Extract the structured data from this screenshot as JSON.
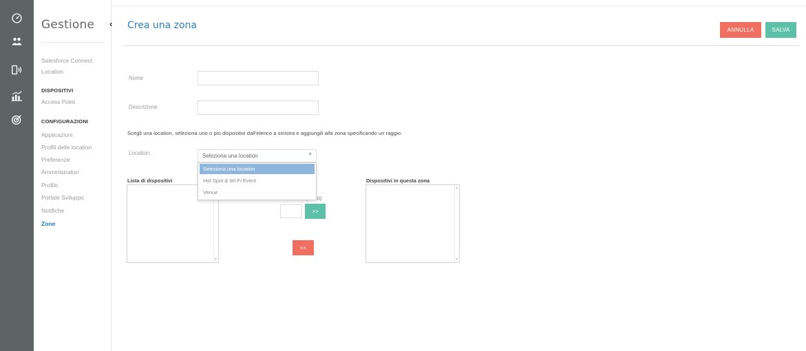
{
  "rail": {
    "icons": [
      "dashboard-icon",
      "users-icon",
      "devices-icon",
      "analytics-icon",
      "target-icon"
    ]
  },
  "sidebar": {
    "title": "Gestione",
    "items": [
      {
        "label": "Salesforce Connect",
        "type": "item"
      },
      {
        "label": "Location",
        "type": "item"
      },
      {
        "label": "DISPOSITIVI",
        "type": "heading"
      },
      {
        "label": "Access Point",
        "type": "item"
      },
      {
        "label": "CONFIGURAZIONI",
        "type": "heading"
      },
      {
        "label": "Applicazioni",
        "type": "item"
      },
      {
        "label": "Profili delle location",
        "type": "item"
      },
      {
        "label": "Preferenze",
        "type": "item"
      },
      {
        "label": "Amministratori",
        "type": "item"
      },
      {
        "label": "Profilo",
        "type": "item"
      },
      {
        "label": "Portale Sviluppo",
        "type": "item"
      },
      {
        "label": "Notifiche",
        "type": "item"
      },
      {
        "label": "Zone",
        "type": "item",
        "active": true
      }
    ]
  },
  "header": {
    "collapse_glyph": "‹",
    "title": "Crea una zona",
    "cancel_label": "ANNULLA",
    "save_label": "SALVA"
  },
  "form": {
    "name_label": "Nome",
    "name_value": "",
    "description_label": "Descrizione",
    "description_value": "",
    "instruction": "Scegli una location, seleziona uno o più dispositivi dall'elenco a sinistra e aggiungili alla zona specificando un raggio.",
    "location_label": "Location",
    "location_selected": "Seleziona una location",
    "location_options": [
      "Seleziona una location",
      "Hot Spot & Wi-Fi Event",
      "Venue"
    ],
    "devices_list_label": "Lista di dispositivi",
    "zone_devices_label": "Dispositivi in questa zona",
    "distance_label": "Distanza (metri)",
    "distance_value": "",
    "add_label": ">>",
    "remove_label": "<<"
  },
  "colors": {
    "rail": "#5e6466",
    "accent_blue": "#2d80bd",
    "cancel_red": "#ef6f60",
    "save_green": "#5dc1aa",
    "option_highlight": "#8fb6dc"
  }
}
